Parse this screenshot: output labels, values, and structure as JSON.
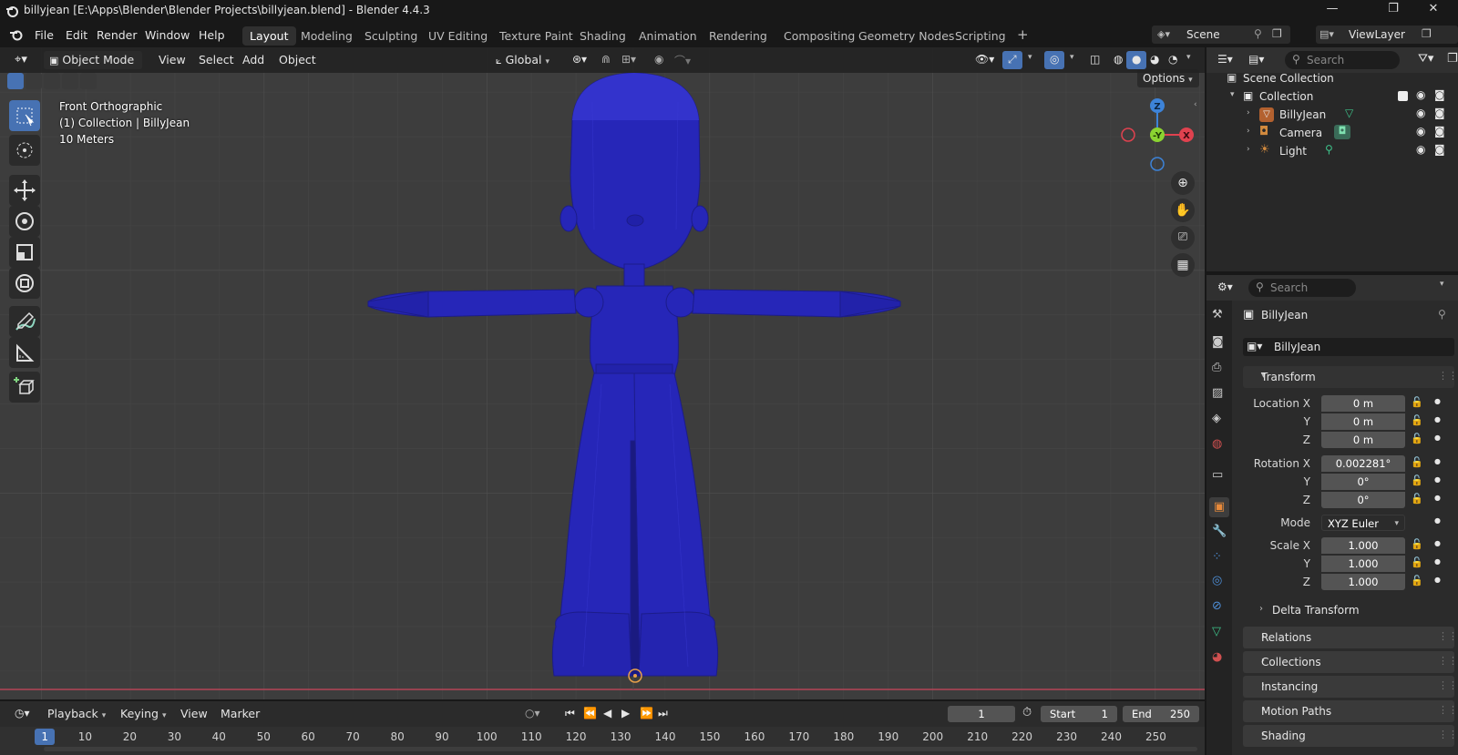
{
  "window": {
    "title": "billyjean [E:\\Apps\\Blender\\Blender Projects\\billyjean.blend] - Blender 4.4.3",
    "controls": [
      "—",
      "❐",
      "✕"
    ]
  },
  "menubar": {
    "menus": [
      "File",
      "Edit",
      "Render",
      "Window",
      "Help"
    ],
    "workspaces": [
      "Layout",
      "Modeling",
      "Sculpting",
      "UV Editing",
      "Texture Paint",
      "Shading",
      "Animation",
      "Rendering",
      "Compositing",
      "Geometry Nodes",
      "Scripting"
    ],
    "active_workspace": "Layout",
    "add_tab": "+",
    "scene": "Scene",
    "view_layer": "ViewLayer"
  },
  "viewport_header": {
    "mode": "Object Mode",
    "menus": [
      "View",
      "Select",
      "Add",
      "Object"
    ],
    "transform_orientation": "Global",
    "options": "Options"
  },
  "viewport_info": {
    "view": "Front Orthographic",
    "collection": "(1) Collection | BillyJean",
    "scale": "10 Meters"
  },
  "gizmo": {
    "z": "Z",
    "y": "-Y",
    "x": "X",
    "colors": {
      "x": "#e0424f",
      "y": "#8bd331",
      "z": "#3d83d8"
    }
  },
  "character": {
    "color": "#2626b8"
  },
  "outliner": {
    "search_placeholder": "Search",
    "scene_collection": "Scene Collection",
    "collection": "Collection",
    "items": [
      {
        "name": "BillyJean",
        "icon": "mesh-icon"
      },
      {
        "name": "Camera",
        "icon": "camera-icon"
      },
      {
        "name": "Light",
        "icon": "light-icon"
      }
    ]
  },
  "properties": {
    "search_placeholder": "Search",
    "object_name": "BillyJean",
    "object_field": "BillyJean",
    "transform": {
      "title": "Transform",
      "location_label": "Location X",
      "location": [
        "0 m",
        "0 m",
        "0 m"
      ],
      "rotation_label": "Rotation X",
      "rotation": [
        "0.002281°",
        "0°",
        "0°"
      ],
      "mode_label": "Mode",
      "mode": "XYZ Euler",
      "scale_label": "Scale X",
      "scale": [
        "1.000",
        "1.000",
        "1.000"
      ],
      "axis_y": "Y",
      "axis_z": "Z"
    },
    "delta_transform": "Delta Transform",
    "panels": [
      "Relations",
      "Collections",
      "Instancing",
      "Motion Paths",
      "Shading"
    ]
  },
  "timeline": {
    "menus": [
      "Playback",
      "Keying",
      "View",
      "Marker"
    ],
    "current_frame": "1",
    "start_label": "Start",
    "start": "1",
    "end_label": "End",
    "end": "250",
    "ruler": [
      "1",
      "10",
      "20",
      "30",
      "40",
      "50",
      "60",
      "70",
      "80",
      "90",
      "100",
      "110",
      "120",
      "130",
      "140",
      "150",
      "160",
      "170",
      "180",
      "190",
      "200",
      "210",
      "220",
      "230",
      "240",
      "250"
    ]
  }
}
